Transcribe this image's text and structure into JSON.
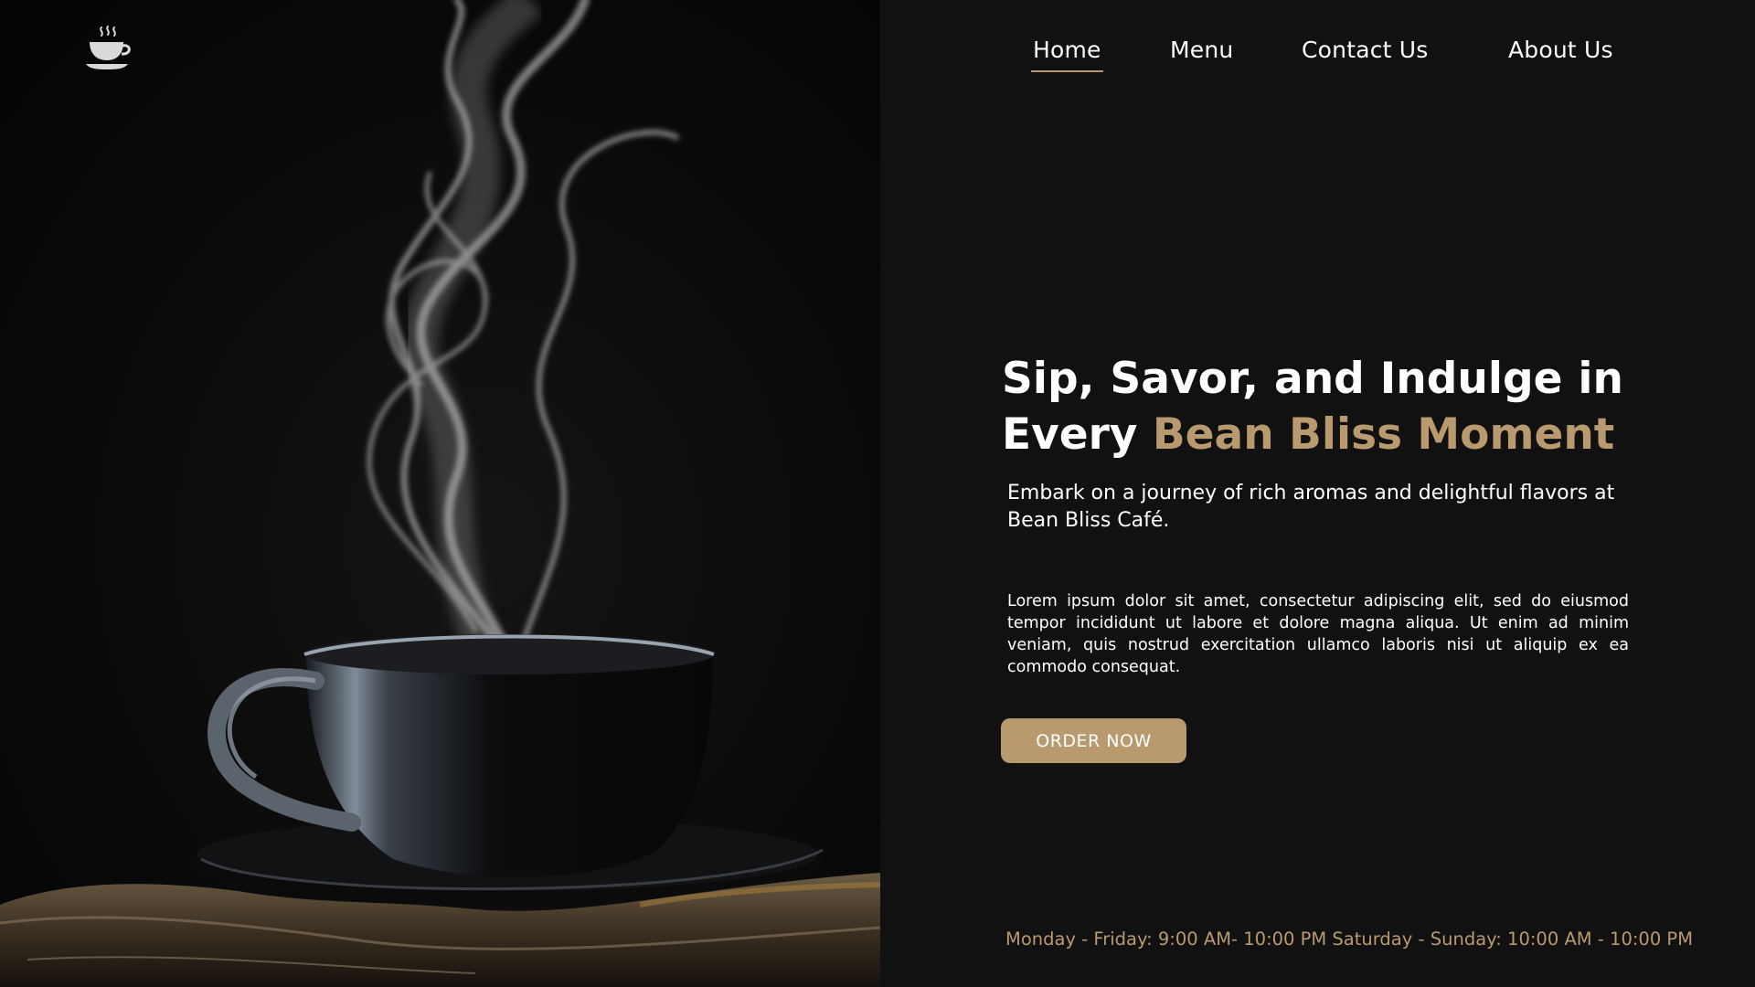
{
  "nav": {
    "items": [
      {
        "label": "Home",
        "active": true
      },
      {
        "label": "Menu",
        "active": false
      },
      {
        "label": "Contact Us",
        "active": false
      },
      {
        "label": "About Us",
        "active": false
      }
    ]
  },
  "logo": {
    "icon": "coffee-cup-icon"
  },
  "hero": {
    "headline_line1": "Sip, Savor, and Indulge in",
    "headline_line2_prefix": "Every ",
    "headline_accent": "Bean Bliss Moment",
    "subheading": "Embark on a journey of rich aromas and delightful flavors at Bean Bliss Café.",
    "body": "Lorem ipsum dolor sit amet, consectetur adipiscing elit, sed do eiusmod tempor incididunt ut labore et dolore magna aliqua. Ut enim ad minim veniam, quis nostrud exercitation ullamco laboris nisi ut aliquip ex ea commodo consequat.",
    "button_label": "ORDER NOW"
  },
  "hours": "Monday - Friday: 9:00 AM- 10:00 PM Saturday - Sunday: 10:00 AM - 10:00 PM",
  "colors": {
    "background": "#121111",
    "accent": "#b99a6e",
    "text": "#ffffff"
  }
}
